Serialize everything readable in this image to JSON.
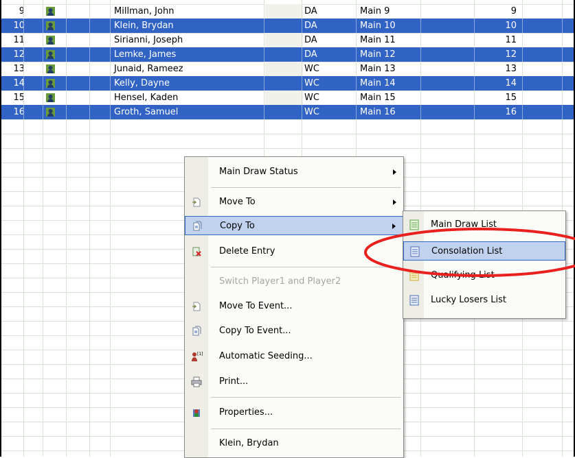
{
  "rows": [
    {
      "num": "9",
      "name": "Millman, John",
      "type": "DA",
      "position": "Main  9",
      "seed": "9",
      "selected": false
    },
    {
      "num": "10",
      "name": "Klein, Brydan",
      "type": "DA",
      "position": "Main  10",
      "seed": "10",
      "selected": true
    },
    {
      "num": "11",
      "name": "Sirianni, Joseph",
      "type": "DA",
      "position": "Main  11",
      "seed": "11",
      "selected": false
    },
    {
      "num": "12",
      "name": "Lemke, James",
      "type": "DA",
      "position": "Main  12",
      "seed": "12",
      "selected": true
    },
    {
      "num": "13",
      "name": "Junaid, Rameez",
      "type": "WC",
      "position": "Main  13",
      "seed": "13",
      "selected": false
    },
    {
      "num": "14",
      "name": "Kelly, Dayne",
      "type": "WC",
      "position": "Main  14",
      "seed": "14",
      "selected": true
    },
    {
      "num": "15",
      "name": "Hensel, Kaden",
      "type": "WC",
      "position": "Main  15",
      "seed": "15",
      "selected": false
    },
    {
      "num": "16",
      "name": "Groth, Samuel",
      "type": "WC",
      "position": "Main  16",
      "seed": "16",
      "selected": true
    }
  ],
  "context_menu": {
    "items": [
      {
        "label": "Main Draw Status",
        "submenu": true,
        "icon": "none"
      },
      {
        "label": "Move To",
        "submenu": true,
        "icon": "move-doc-icon"
      },
      {
        "label": "Copy To",
        "submenu": true,
        "icon": "copy-doc-icon",
        "highlighted": true
      },
      {
        "label": "Delete Entry",
        "icon": "delete-entry-icon"
      },
      {
        "label": "Switch Player1 and Player2",
        "disabled": true,
        "icon": "none"
      },
      {
        "label": "Move To Event...",
        "icon": "move-doc-icon"
      },
      {
        "label": "Copy To Event...",
        "icon": "copy-doc-icon"
      },
      {
        "label": "Automatic Seeding...",
        "icon": "seeding-icon"
      },
      {
        "label": "Print...",
        "icon": "printer-icon"
      },
      {
        "label": "Properties...",
        "icon": "properties-icon"
      },
      {
        "label": "Klein, Brydan",
        "icon": "none"
      }
    ]
  },
  "copy_to_submenu": {
    "items": [
      {
        "label": "Main Draw List",
        "icon": "green-list-icon"
      },
      {
        "label": "Consolation List",
        "icon": "blue-list-icon",
        "highlighted": true
      },
      {
        "label": "Qualifying List",
        "icon": "yellow-list-icon"
      },
      {
        "label": "Lucky Losers List",
        "icon": "blue-list-icon"
      }
    ]
  },
  "colors": {
    "selection": "#3163c5",
    "menu_hover": "#c1d2ee",
    "annotation": "#e8201e"
  }
}
